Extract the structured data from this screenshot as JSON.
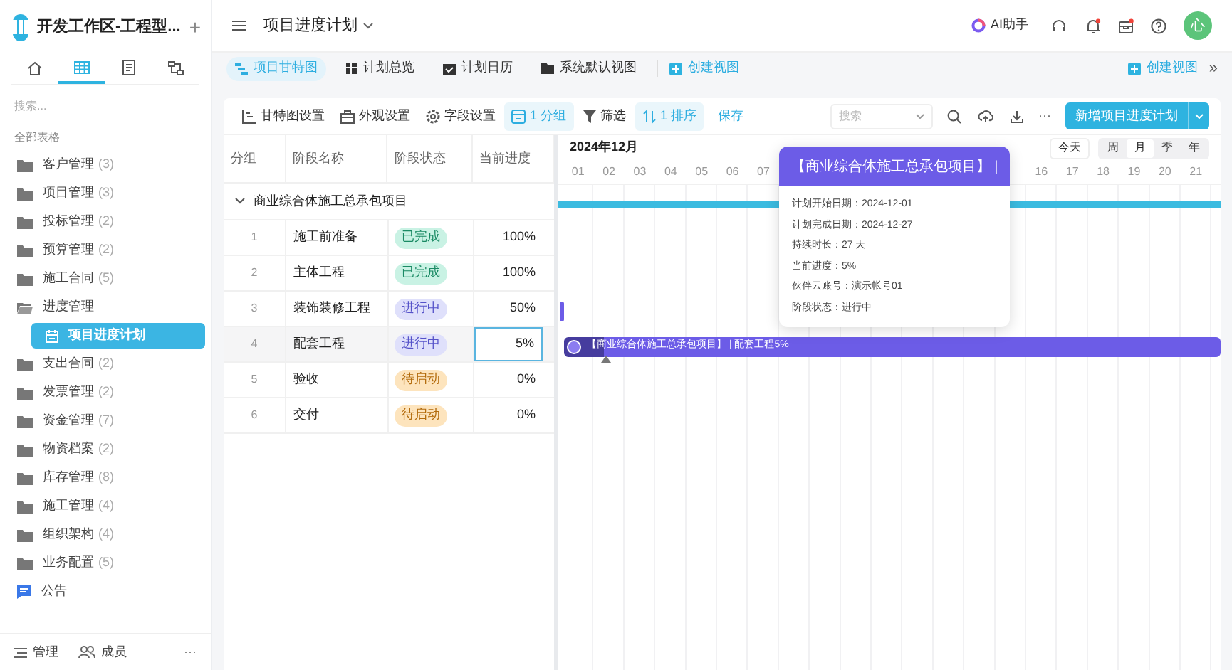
{
  "workspace": {
    "title": "开发工作区-工程型...",
    "add": "+"
  },
  "sidebar_tabs": [
    {
      "selected": false
    },
    {
      "selected": true
    },
    {
      "selected": false
    },
    {
      "selected": false
    }
  ],
  "search": {
    "placeholder": "搜索..."
  },
  "section_label": "全部表格",
  "tree": [
    {
      "label": "客户管理",
      "count": "(3)",
      "kind": "folder",
      "selected": false
    },
    {
      "label": "项目管理",
      "count": "(3)",
      "kind": "folder",
      "selected": false
    },
    {
      "label": "投标管理",
      "count": "(2)",
      "kind": "folder",
      "selected": false
    },
    {
      "label": "预算管理",
      "count": "(2)",
      "kind": "folder",
      "selected": false
    },
    {
      "label": "施工合同",
      "count": "(5)",
      "kind": "folder",
      "selected": false
    },
    {
      "label": "进度管理",
      "kind": "folder",
      "selected": false,
      "expanded": true,
      "children": [
        {
          "label": "项目进度计划",
          "kind": "table",
          "selected": true
        }
      ]
    },
    {
      "label": "支出合同",
      "count": "(2)",
      "kind": "folder",
      "selected": false
    },
    {
      "label": "发票管理",
      "count": "(2)",
      "kind": "folder",
      "selected": false
    },
    {
      "label": "资金管理",
      "count": "(7)",
      "kind": "folder",
      "selected": false
    },
    {
      "label": "物资档案",
      "count": "(2)",
      "kind": "folder",
      "selected": false
    },
    {
      "label": "库存管理",
      "count": "(8)",
      "kind": "folder",
      "selected": false
    },
    {
      "label": "施工管理",
      "count": "(4)",
      "kind": "folder",
      "selected": false
    },
    {
      "label": "组织架构",
      "count": "(4)",
      "kind": "folder",
      "selected": false
    },
    {
      "label": "业务配置",
      "count": "(5)",
      "kind": "folder",
      "selected": false
    },
    {
      "label": "公告",
      "kind": "notice",
      "selected": false
    }
  ],
  "sidebar_footer": {
    "manage": "管理",
    "members": "成员",
    "more": "···"
  },
  "header": {
    "title": "项目进度计划",
    "ai": "AI助手",
    "avatar": "心"
  },
  "views": [
    {
      "label": "项目甘特图",
      "selected": true
    },
    {
      "label": "计划总览",
      "selected": false
    },
    {
      "label": "计划日历",
      "selected": false
    },
    {
      "label": "系统默认视图",
      "selected": false
    }
  ],
  "create_view": "创建视图",
  "create_view_right": "创建视图",
  "more_views": "»",
  "toolbar": [
    {
      "label": "甘特图设置",
      "active": false
    },
    {
      "label": "外观设置",
      "active": false
    },
    {
      "label": "字段设置",
      "active": false
    },
    {
      "label": "1 分组",
      "active": true
    },
    {
      "label": "筛选",
      "active": false
    },
    {
      "label": "1 排序",
      "active": true
    }
  ],
  "save": "保存",
  "table_search": {
    "placeholder": "搜索"
  },
  "more": "···",
  "new_button": "新增项目进度计划",
  "table": {
    "columns": [
      "分组",
      "阶段名称",
      "阶段状态",
      "当前进度"
    ],
    "group": {
      "label": "商业综合体施工总承包项目",
      "expanded": true
    },
    "rows": [
      {
        "index": "1",
        "name": "施工前准备",
        "status": "已完成",
        "kind": "done",
        "progress": "100%",
        "selected": false
      },
      {
        "index": "2",
        "name": "主体工程",
        "status": "已完成",
        "kind": "done",
        "progress": "100%",
        "selected": false
      },
      {
        "index": "3",
        "name": "装饰装修工程",
        "status": "进行中",
        "kind": "doing",
        "progress": "50%",
        "selected": false
      },
      {
        "index": "4",
        "name": "配套工程",
        "status": "进行中",
        "kind": "doing",
        "progress": "5%",
        "selected": true
      },
      {
        "index": "5",
        "name": "验收",
        "status": "待启动",
        "kind": "todo",
        "progress": "0%",
        "selected": false
      },
      {
        "index": "6",
        "name": "交付",
        "status": "待启动",
        "kind": "todo",
        "progress": "0%",
        "selected": false
      }
    ]
  },
  "gantt": {
    "month": "2024年12月",
    "today": "今天",
    "scales": [
      {
        "label": "周",
        "selected": false
      },
      {
        "label": "月",
        "selected": true
      },
      {
        "label": "季",
        "selected": false
      },
      {
        "label": "年",
        "selected": false
      }
    ],
    "days_before": [
      "01",
      "02",
      "03",
      "04",
      "05",
      "06",
      "07"
    ],
    "days_after": [
      "16",
      "17",
      "18",
      "19",
      "20",
      "21"
    ],
    "bar_label": "【商业综合体施工总承包项目】 | 配套工程5%"
  },
  "tooltip": {
    "title": "【商业综合体施工总承包项目】 |",
    "lines": [
      "计划开始日期：2024-12-01",
      "计划完成日期：2024-12-27",
      "持续时长：27 天",
      "当前进度：5%",
      "伙伴云账号：演示帐号01",
      "阶段状态：进行中"
    ]
  }
}
